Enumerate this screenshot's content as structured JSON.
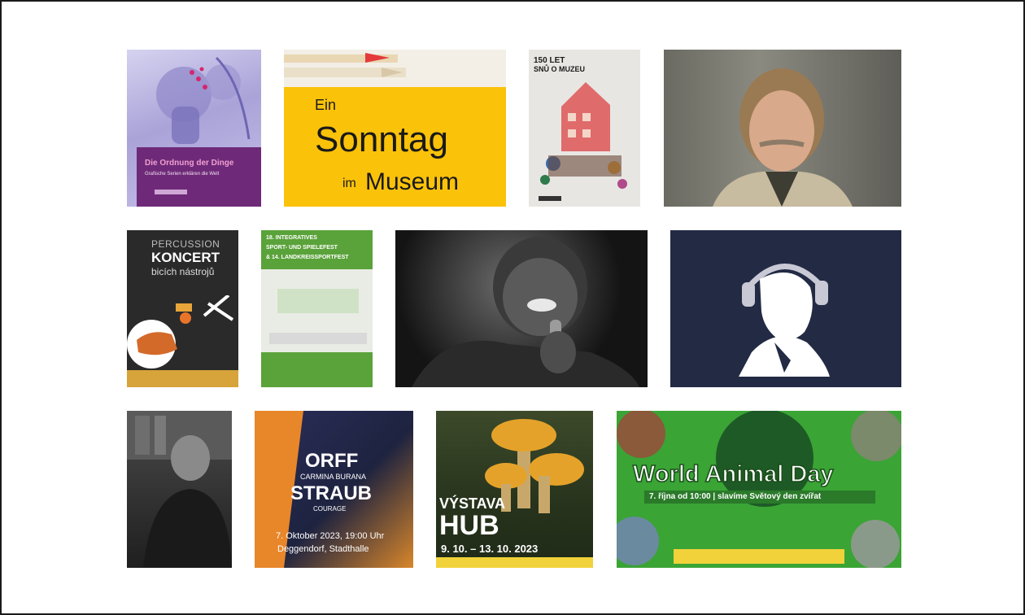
{
  "tiles": {
    "ordnung": {
      "title": "Die Ordnung der Dinge",
      "subtitle": "Grafische Serien erklären die Welt",
      "colors": {
        "band": "#6e2a78",
        "title": "#f29fd1"
      }
    },
    "sonntag": {
      "line1": "Ein",
      "line2": "Sonntag",
      "line3_prefix": "im",
      "line3": "Museum"
    },
    "muzeu": {
      "title_line1": "150 LET",
      "title_line2": "SNŮ O MUZEU"
    },
    "percussion": {
      "line1": "PERCUSSION",
      "line2": "KONCERT",
      "line3": "bicích nástrojů"
    },
    "sportfest": {
      "line1": "18. INTEGRATIVES",
      "line2": "SPORT- UND SPIELEFEST",
      "line3": "& 14. LANDKREISSPORTFEST"
    },
    "orff": {
      "line1": "ORFF",
      "line2": "CARMINA BURANA",
      "line3": "STRAUB",
      "line4": "COURAGE",
      "date": "7. Oktober 2023, 19:00 Uhr",
      "venue": "Deggendorf, Stadthalle"
    },
    "hub": {
      "line1": "VÝSTAVA",
      "line2": "HUB",
      "dates": "9. 10. – 13. 10. 2023"
    },
    "animal": {
      "title": "World Animal Day",
      "subtitle": "7. října od 10:00 | slavíme Světový den zvířat",
      "colors": {
        "title": "#ffffff",
        "stroke": "#1a4d1a"
      }
    }
  }
}
